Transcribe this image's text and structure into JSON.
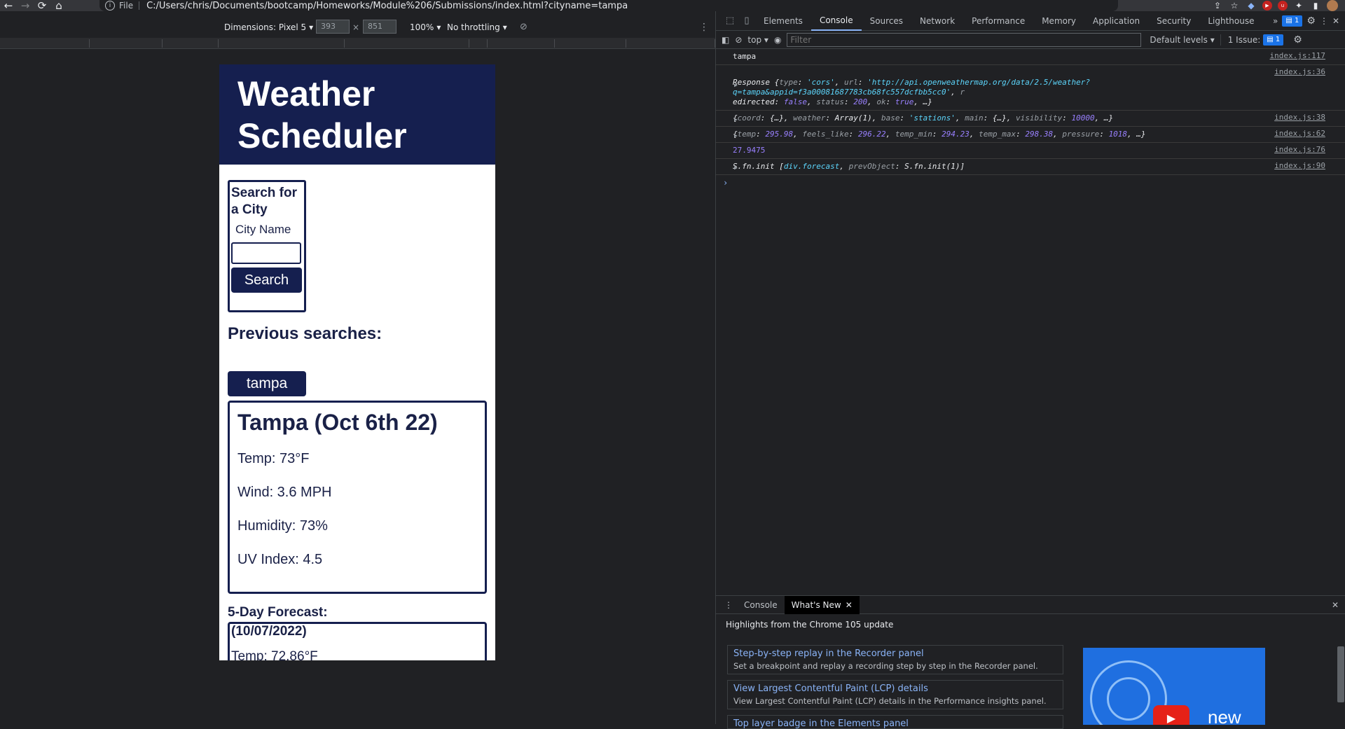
{
  "browser": {
    "scheme": "File",
    "url": "C:/Users/chris/Documents/bootcamp/Homeworks/Module%206/Submissions/index.html?cityname=tampa"
  },
  "device_toolbar": {
    "dimensions": "Dimensions: Pixel 5",
    "width": "393",
    "height": "851",
    "times": "×",
    "zoom": "100%",
    "throttling": "No throttling"
  },
  "app": {
    "title_line1": "Weather",
    "title_line2": "Scheduler",
    "search": {
      "heading": "Search for a City",
      "city_label": "City Name",
      "input_value": "",
      "button": "Search"
    },
    "previous": {
      "heading": "Previous searches:",
      "items": [
        "tampa"
      ]
    },
    "current": {
      "title": "Tampa (Oct 6th 22)",
      "temp": "Temp: 73°F",
      "wind": "Wind: 3.6 MPH",
      "humidity": "Humidity: 73%",
      "uv": "UV Index: 4.5"
    },
    "forecast": {
      "heading": "5-Day Forecast:",
      "first_date": "(10/07/2022)",
      "first_temp": "Temp: 72.86°F"
    }
  },
  "devtools": {
    "tabs": [
      "Elements",
      "Console",
      "Sources",
      "Network",
      "Performance",
      "Memory",
      "Application",
      "Security",
      "Lighthouse"
    ],
    "active_tab": "Console",
    "more_tabs": "»",
    "message_badge": "1",
    "console_toolbar": {
      "context": "top",
      "filter_placeholder": "Filter",
      "levels": "Default levels",
      "issues": "1 Issue:",
      "issues_count": "1"
    },
    "logs": [
      {
        "text": "tampa",
        "source": "index.js:117"
      },
      {
        "source": "index.js:36"
      },
      {
        "source": "index.js:38"
      },
      {
        "source": "index.js:62"
      },
      {
        "text": "27.9475",
        "source": "index.js:76"
      },
      {
        "source": "index.js:90"
      }
    ],
    "prompt": "›",
    "drawer": {
      "tabs": [
        "Console",
        "What's New"
      ],
      "active_tab": "What's New",
      "highlights": "Highlights from the Chrome 105 update",
      "news": [
        {
          "title": "Step-by-step replay in the Recorder panel",
          "desc": "Set a breakpoint and replay a recording step by step in the Recorder panel."
        },
        {
          "title": "View Largest Contentful Paint (LCP) details",
          "desc": "View Largest Contentful Paint (LCP) details in the Performance insights panel."
        },
        {
          "title": "Top layer badge in the Elements panel",
          "desc": ""
        }
      ],
      "video_text": "new"
    }
  }
}
